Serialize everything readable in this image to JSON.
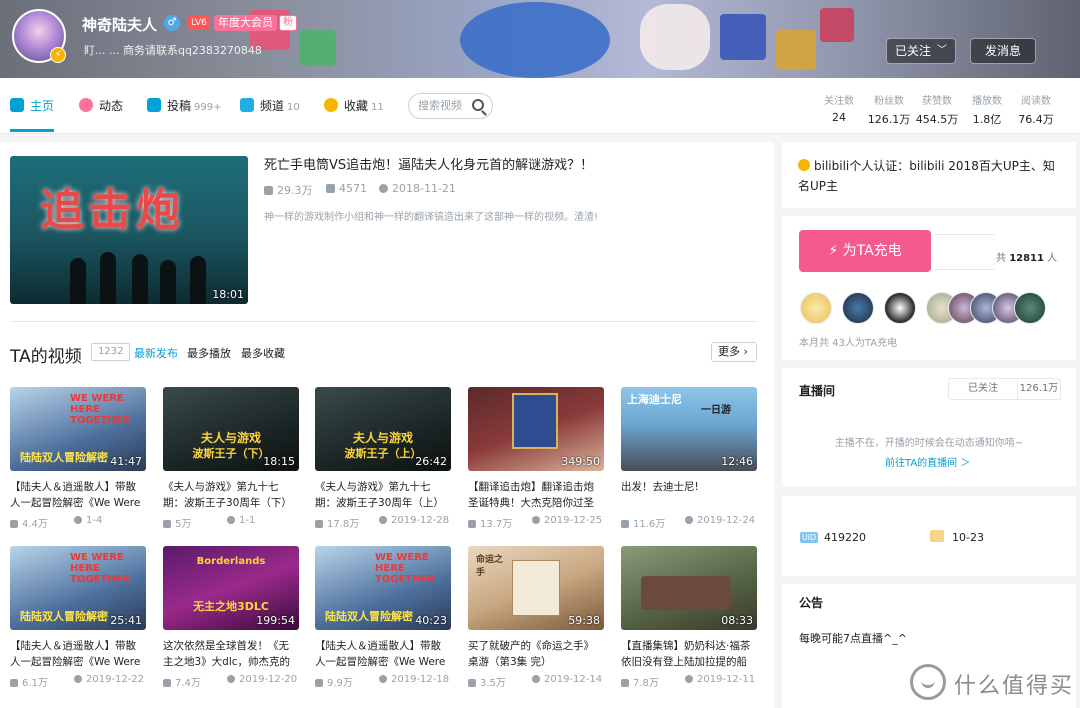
{
  "colors": {
    "accent": "#00a1d6",
    "pink": "#fb7299",
    "charge": "#f45a8d",
    "muted": "#99a2aa"
  },
  "header": {
    "username": "神奇陆夫人",
    "gender_icon": "male-icon",
    "level": "LV6",
    "vip": "年度大会员",
    "fan_badge": "粉",
    "sign": "盯... ... 商务请联系qq2383270848",
    "followed_label": "已关注",
    "message_label": "发消息"
  },
  "nav": {
    "items": [
      {
        "label": "主页",
        "count": "",
        "icon": "home-icon"
      },
      {
        "label": "动态",
        "count": "",
        "icon": "dynamic-icon"
      },
      {
        "label": "投稿",
        "count": "999+",
        "icon": "upload-icon"
      },
      {
        "label": "频道",
        "count": "10",
        "icon": "channel-icon"
      },
      {
        "label": "收藏",
        "count": "11",
        "icon": "star-icon"
      }
    ],
    "search_placeholder": "搜索视频",
    "stats": [
      {
        "label": "关注数",
        "value": "24"
      },
      {
        "label": "粉丝数",
        "value": "126.1万"
      },
      {
        "label": "获赞数",
        "value": "454.5万"
      },
      {
        "label": "播放数",
        "value": "1.8亿"
      },
      {
        "label": "阅读数",
        "value": "76.4万"
      }
    ]
  },
  "featured": {
    "thumb_text": "追击炮",
    "duration": "18:01",
    "title": "死亡手电筒VS追击炮！逼陆夫人化身元首的解谜游戏？！",
    "plays": "29.3万",
    "danmaku": "4571",
    "date": "2018-11-21",
    "desc": "神一样的游戏制作小组和神一样的翻译镐造出来了这部神一样的视频。渣渣!"
  },
  "videos_section": {
    "title": "TA的视频",
    "count": "1232",
    "tabs": [
      "最新发布",
      "最多播放",
      "最多收藏"
    ],
    "more": "更多"
  },
  "videos": [
    {
      "cap": "WE WERE HERE TOGETHER",
      "cap2": "陆陆双人冒险解密",
      "duration": "41:47",
      "title": "【陆夫人＆逍遥散人】带散人一起冒险解密《We Were",
      "plays": "4.4万",
      "date": "1-4"
    },
    {
      "cap": "夫人与游戏",
      "cap2": "波斯王子（下）",
      "duration": "18:15",
      "title": "《夫人与游戏》第九十七期：波斯王子30周年（下）",
      "plays": "5万",
      "date": "1-1"
    },
    {
      "cap": "夫人与游戏",
      "cap2": "波斯王子（上）",
      "duration": "26:42",
      "title": "《夫人与游戏》第九十七期：波斯王子30周年（上）",
      "plays": "17.8万",
      "date": "2019-12-28"
    },
    {
      "cap": "",
      "cap2": "",
      "duration": "349:50",
      "title": "【翻译追击炮】翻译追击炮圣诞特典！大杰克陪你过圣诞!",
      "plays": "13.7万",
      "date": "2019-12-25"
    },
    {
      "cap": "上海迪士尼",
      "cap2": "一日游",
      "duration": "12:46",
      "title": "出发！去迪士尼!",
      "plays": "11.6万",
      "date": "2019-12-24"
    },
    {
      "cap": "WE WERE HERE TOGETHER",
      "cap2": "陆陆双人冒险解密",
      "duration": "25:41",
      "title": "【陆夫人＆逍遥散人】带散人一起冒险解密《We Were",
      "plays": "6.1万",
      "date": "2019-12-22"
    },
    {
      "cap": "Borderlands",
      "cap2": "无主之地3DLC",
      "duration": "199:54",
      "title": "这次依然是全球首发！《无主之地3》大dlc，帅杰克的大賭",
      "plays": "7.4万",
      "date": "2019-12-20"
    },
    {
      "cap": "WE WERE HERE TOGETHER",
      "cap2": "陆陆双人冒险解密",
      "duration": "40:23",
      "title": "【陆夫人＆逍遥散人】带散人一起冒险解密《We Were",
      "plays": "9.9万",
      "date": "2019-12-18"
    },
    {
      "cap": "命运之手",
      "cap2": "",
      "duration": "59:38",
      "title": "买了就破产的《命运之手》桌游（第3集 完）",
      "plays": "3.5万",
      "date": "2019-12-14"
    },
    {
      "cap": "",
      "cap2": "",
      "duration": "08:33",
      "title": "【直播集锦】奶奶科达·福茶依旧没有登上陆加拉提的船",
      "plays": "7.8万",
      "date": "2019-12-11"
    }
  ],
  "sidebar": {
    "verify": "bilibili个人认证：bilibili 2018百大UP主、知名UP主",
    "charge_label": "为TA充电",
    "charge_total_prefix": "共",
    "charge_total": "12811",
    "charge_total_suffix": "人",
    "charge_note": "本月共 43人为TA充电",
    "live_title": "直播间",
    "live_followed": "已关注",
    "live_fans": "126.1万",
    "live_note": "主播不在，开播的时候会在动态通知你唷~",
    "live_link": "前往TA的直播间 ＞",
    "uid_icon": "UID",
    "uid": "419220",
    "birthday": "10-23",
    "notice_title": "公告",
    "notice_text": "每晚可能7点直播^_^"
  },
  "watermark": "什么值得买"
}
